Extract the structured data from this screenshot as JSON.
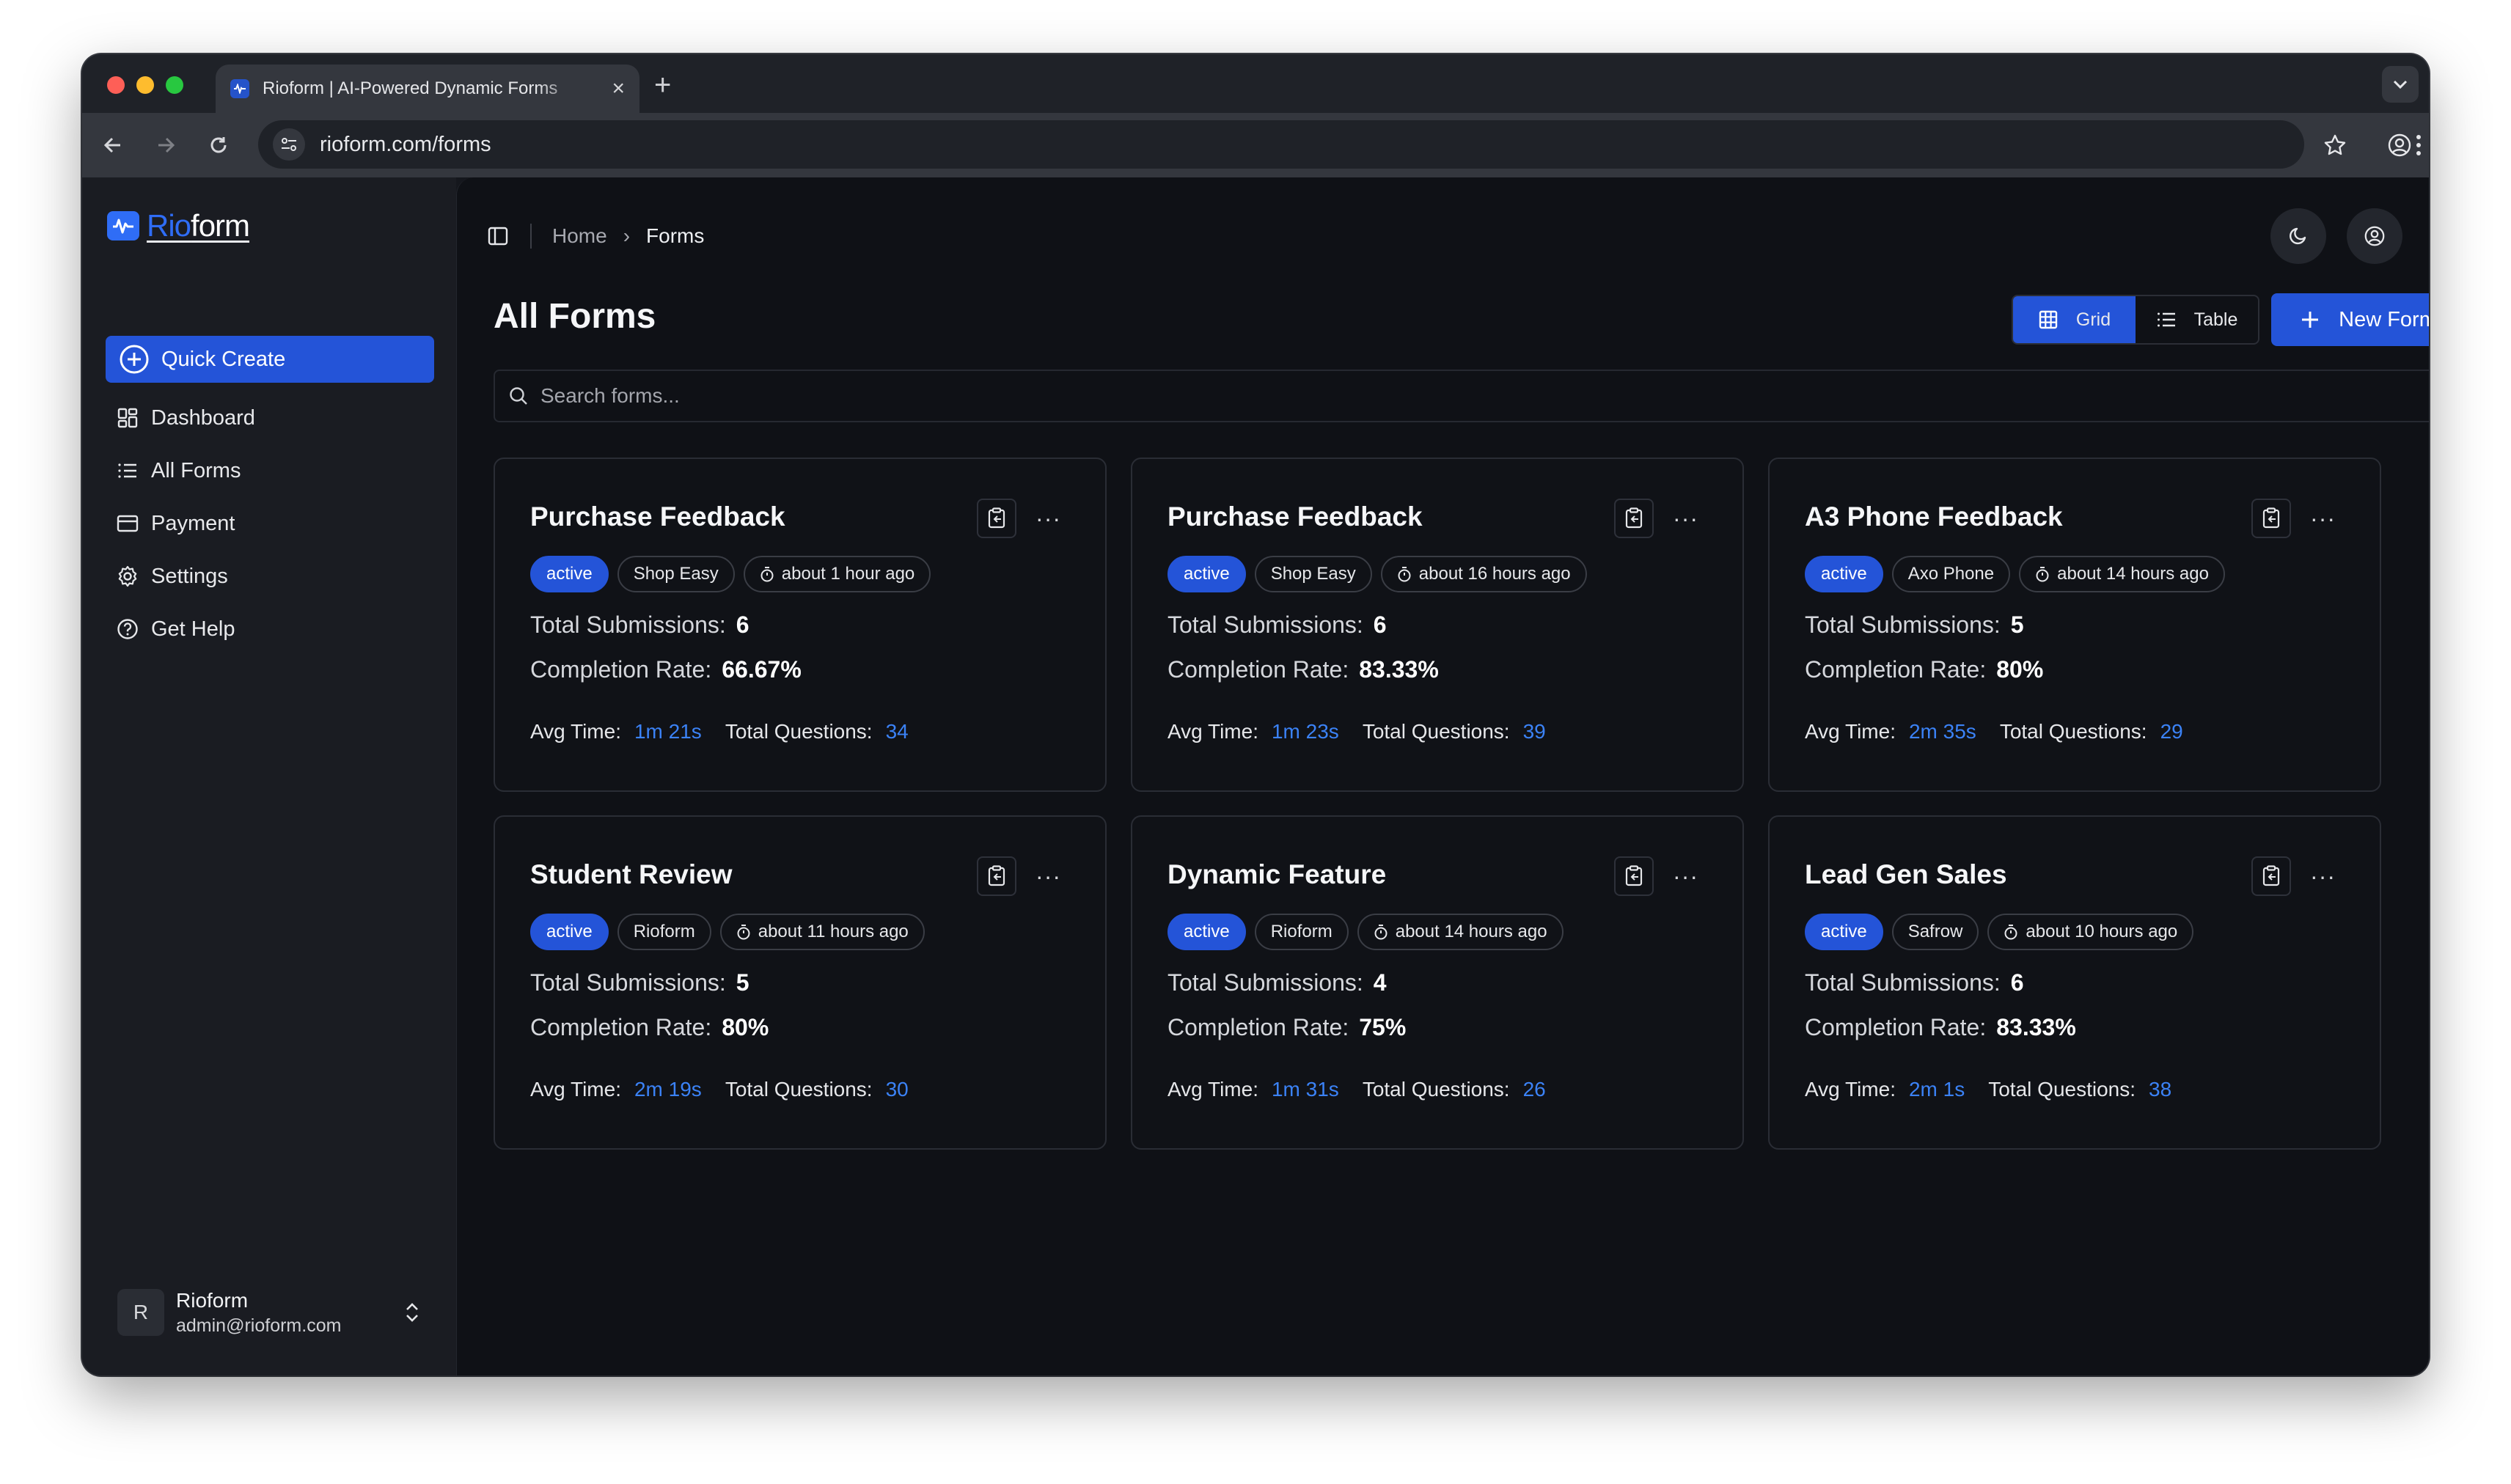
{
  "browser": {
    "tab_title": "Rioform | AI-Powered Dynamic Forms",
    "url": "rioform.com/forms"
  },
  "sidebar": {
    "logo_rio": "Rio",
    "logo_form": "form",
    "quick_create": "Quick Create",
    "items": [
      {
        "label": "Dashboard",
        "icon": "dashboard-icon"
      },
      {
        "label": "All Forms",
        "icon": "list-icon"
      },
      {
        "label": "Payment",
        "icon": "credit-card-icon"
      },
      {
        "label": "Settings",
        "icon": "gear-icon"
      },
      {
        "label": "Get Help",
        "icon": "help-circle-icon"
      }
    ],
    "user": {
      "initial": "R",
      "name": "Rioform",
      "email": "admin@rioform.com"
    }
  },
  "breadcrumb": {
    "home": "Home",
    "current": "Forms"
  },
  "page": {
    "title": "All Forms",
    "view_grid": "Grid",
    "view_table": "Table",
    "new_form": "New Form",
    "search_placeholder": "Search forms..."
  },
  "labels": {
    "total_submissions": "Total Submissions:",
    "completion_rate": "Completion Rate:",
    "avg_time": "Avg Time:",
    "total_questions": "Total Questions:"
  },
  "forms": [
    {
      "title": "Purchase Feedback",
      "status": "active",
      "brand": "Shop Easy",
      "updated": "about 1 hour ago",
      "submissions": "6",
      "completion": "66.67%",
      "avg_time": "1m 21s",
      "questions": "34"
    },
    {
      "title": "Purchase Feedback",
      "status": "active",
      "brand": "Shop Easy",
      "updated": "about 16 hours ago",
      "submissions": "6",
      "completion": "83.33%",
      "avg_time": "1m 23s",
      "questions": "39"
    },
    {
      "title": "A3 Phone Feedback",
      "status": "active",
      "brand": "Axo Phone",
      "updated": "about 14 hours ago",
      "submissions": "5",
      "completion": "80%",
      "avg_time": "2m 35s",
      "questions": "29"
    },
    {
      "title": "Student Review",
      "status": "active",
      "brand": "Rioform",
      "updated": "about 11 hours ago",
      "submissions": "5",
      "completion": "80%",
      "avg_time": "2m 19s",
      "questions": "30"
    },
    {
      "title": "Dynamic Feature",
      "status": "active",
      "brand": "Rioform",
      "updated": "about 14 hours ago",
      "submissions": "4",
      "completion": "75%",
      "avg_time": "1m 31s",
      "questions": "26"
    },
    {
      "title": "Lead Gen Sales",
      "status": "active",
      "brand": "Safrow",
      "updated": "about 10 hours ago",
      "submissions": "6",
      "completion": "83.33%",
      "avg_time": "2m 1s",
      "questions": "38"
    }
  ],
  "colors": {
    "accent": "#2454d8",
    "link": "#3b82f6",
    "background": "#0f1116",
    "sidebar": "#1a1c22"
  }
}
